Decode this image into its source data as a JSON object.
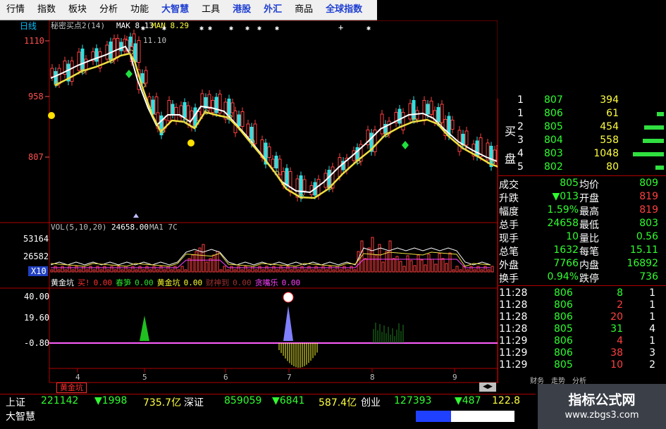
{
  "menu": [
    "行情",
    "指数",
    "板块",
    "分析",
    "功能",
    "大智慧",
    "工具",
    "港股",
    "外汇",
    "商品",
    "全球指数"
  ],
  "price_panel": {
    "period": "日线",
    "indicator_header": "秘密买点2(14)",
    "mak": "MAK 8.13",
    "man": "MAN 8.29",
    "axis": [
      "1110",
      "958",
      "807"
    ],
    "high_label": "11.10"
  },
  "volume_panel": {
    "header": "VOL(5,10,20)",
    "value": "24658.00",
    "ma": "MA1 7C",
    "axis": [
      "53164",
      "26582",
      "X10"
    ]
  },
  "indicator_panel": {
    "items": [
      {
        "name": "黄金坑",
        "color": "#ffffff"
      },
      {
        "name": "买!",
        "color": "#ff3030"
      },
      {
        "name": "0.00",
        "color": "#ff3030"
      },
      {
        "name": "春笋",
        "color": "#2ee02e"
      },
      {
        "name": "0.00",
        "color": "#2ee02e"
      },
      {
        "name": "黄金坑",
        "color": "#ffff30"
      },
      {
        "name": "0.00",
        "color": "#ffff30"
      },
      {
        "name": "财神到",
        "color": "#a03030"
      },
      {
        "name": "0.00",
        "color": "#a03030"
      },
      {
        "name": "贪嘴乐",
        "color": "#ff40ff"
      },
      {
        "name": "0.00",
        "color": "#ff40ff"
      }
    ],
    "axis": [
      "40.00",
      "19.60",
      "-0.80"
    ]
  },
  "date_ticks": [
    "4",
    "5",
    "6",
    "7",
    "8",
    "9"
  ],
  "tab_label": "黄金坑",
  "order_book": {
    "buy_label": "买",
    "pan_label": "盘",
    "rows": [
      {
        "level": "1",
        "price": "807",
        "vol": "394"
      },
      {
        "level": "1",
        "price": "806",
        "vol": "61"
      },
      {
        "level": "2",
        "price": "805",
        "vol": "454"
      },
      {
        "level": "3",
        "price": "804",
        "vol": "558"
      },
      {
        "level": "4",
        "price": "803",
        "vol": "1048"
      },
      {
        "level": "5",
        "price": "802",
        "vol": "80"
      }
    ]
  },
  "stats": [
    {
      "l1": "成交",
      "v1": "805",
      "l2": "均价",
      "v2": "809"
    },
    {
      "l1": "升跌",
      "v1": "▼013",
      "l2": "开盘",
      "v2": "819"
    },
    {
      "l1": "幅度",
      "v1": "1.59%",
      "l2": "最高",
      "v2": "819"
    },
    {
      "l1": "总手",
      "v1": "24658",
      "l2": "最低",
      "v2": "803"
    },
    {
      "l1": "现手",
      "v1": "10",
      "l2": "量比",
      "v2": "0.56"
    },
    {
      "l1": "总笔",
      "v1": "1632",
      "l2": "每笔",
      "v2": "15.11"
    },
    {
      "l1": "外盘",
      "v1": "7766",
      "l2": "内盘",
      "v2": "16892"
    },
    {
      "l1": "换手",
      "v1": "0.94%",
      "l2": "跌停",
      "v2": "736"
    }
  ],
  "ticks": [
    {
      "time": "11:28",
      "price": "806",
      "vol": "8",
      "n": "1"
    },
    {
      "time": "11:28",
      "price": "806",
      "vol": "2",
      "n": "1"
    },
    {
      "time": "11:28",
      "price": "806",
      "vol": "20",
      "n": "1"
    },
    {
      "time": "11:28",
      "price": "805",
      "vol": "31",
      "n": "4"
    },
    {
      "time": "11:29",
      "price": "806",
      "vol": "4",
      "n": "1"
    },
    {
      "time": "11:29",
      "price": "806",
      "vol": "38",
      "n": "3"
    },
    {
      "time": "11:29",
      "price": "805",
      "vol": "10",
      "n": "2"
    }
  ],
  "bottom_tabs": [
    "财务",
    "走势",
    "分析"
  ],
  "status": {
    "sh_label": "上证",
    "sh_val": "221142",
    "sh_chg": "▼1998",
    "sh_amt": "735.7亿",
    "sz_label": "深证",
    "sz_val": "859059",
    "sz_chg": "▼6841",
    "sz_amt": "587.4亿",
    "cy_label": "创业",
    "cy_val": "127393",
    "cy_chg": "▼487",
    "cy_amt": "122.8",
    "brand": "大智慧"
  },
  "watermark": {
    "title": "指标公式网",
    "url": "www.zbgs3.com"
  }
}
